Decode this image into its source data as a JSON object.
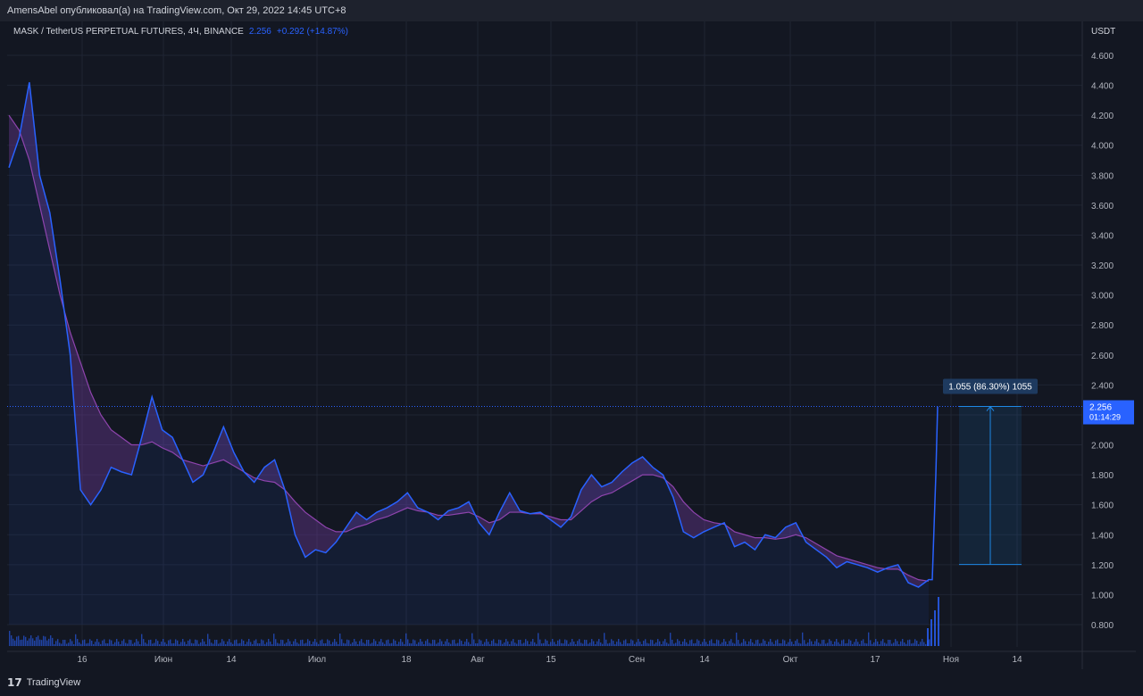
{
  "header": {
    "publisher_text": "AmensAbel опубликовал(а) на TradingView.com, Окт 29, 2022 14:45 UTC+8"
  },
  "symbol": {
    "name": "MASK / TetherUS PERPETUAL FUTURES, 4Ч, BINANCE",
    "price": "2.256",
    "change": "+0.292 (+14.87%)"
  },
  "price_axis": {
    "currency": "USDT",
    "ticks": [
      "4.600",
      "4.400",
      "4.200",
      "4.000",
      "3.800",
      "3.600",
      "3.400",
      "3.200",
      "3.000",
      "2.800",
      "2.600",
      "2.400",
      "2.200",
      "2.000",
      "1.800",
      "1.600",
      "1.400",
      "1.200",
      "1.000",
      "0.800"
    ]
  },
  "time_axis": {
    "ticks": [
      "16",
      "Июн",
      "14",
      "Июл",
      "18",
      "Авг",
      "15",
      "Сен",
      "14",
      "Окт",
      "17",
      "Ноя",
      "14"
    ]
  },
  "price_badge": {
    "price": "2.256",
    "countdown": "01:14:29"
  },
  "measure_label": "1.055 (86.30%) 1055",
  "footer": {
    "brand": "TradingView"
  },
  "colors": {
    "background": "#131722",
    "price_line": "#2962ff",
    "ribbon_purple": "#7b3fa8",
    "ribbon_green": "#26a69a",
    "measure": "#1e88e5"
  },
  "chart_data": {
    "type": "line",
    "ylabel": "USDT",
    "ylim": [
      0.7,
      4.75
    ],
    "x": [
      0,
      2,
      4,
      6,
      8,
      10,
      12,
      14,
      16,
      18,
      20,
      22,
      24,
      26,
      28,
      30,
      32,
      34,
      36,
      38,
      40,
      42,
      44,
      46,
      48,
      50,
      52,
      54,
      56,
      58,
      60,
      62,
      64,
      66,
      68,
      70,
      72,
      74,
      76,
      78,
      80,
      82,
      84,
      86,
      88,
      90,
      92,
      94,
      96,
      98,
      100,
      102,
      104,
      106,
      108,
      110,
      112,
      114,
      116,
      118,
      120,
      122,
      124,
      126,
      128,
      130,
      132,
      134,
      136,
      138,
      140,
      142,
      144,
      146,
      148,
      150,
      152,
      154,
      156,
      158,
      160,
      162,
      164,
      166,
      168,
      170,
      172,
      174,
      176,
      178,
      180
    ],
    "series": [
      {
        "values": [
          3.85,
          4.05,
          4.42,
          3.8,
          3.55,
          3.1,
          2.6,
          1.7,
          1.6,
          1.7,
          1.85,
          1.82,
          1.8,
          2.05,
          2.32,
          2.1,
          2.05,
          1.9,
          1.75,
          1.8,
          1.95,
          2.12,
          1.95,
          1.82,
          1.75,
          1.85,
          1.9,
          1.7,
          1.4,
          1.25,
          1.3,
          1.28,
          1.35,
          1.45,
          1.55,
          1.5,
          1.55,
          1.58,
          1.62,
          1.68,
          1.58,
          1.55,
          1.5,
          1.56,
          1.58,
          1.62,
          1.48,
          1.4,
          1.55,
          1.68,
          1.56,
          1.54,
          1.55,
          1.5,
          1.45,
          1.52,
          1.7,
          1.8,
          1.72,
          1.75,
          1.82,
          1.88,
          1.92,
          1.85,
          1.8,
          1.65,
          1.42,
          1.38,
          1.42,
          1.45,
          1.48,
          1.32,
          1.35,
          1.3,
          1.4,
          1.38,
          1.45,
          1.48,
          1.35,
          1.3,
          1.25,
          1.18,
          1.22,
          1.2,
          1.18,
          1.15,
          1.18,
          1.2,
          1.08,
          1.05,
          1.1
        ]
      },
      {
        "values": [
          4.2,
          4.1,
          3.9,
          3.6,
          3.3,
          3.0,
          2.75,
          2.55,
          2.35,
          2.2,
          2.1,
          2.05,
          2.0,
          2.0,
          2.02,
          1.98,
          1.95,
          1.9,
          1.88,
          1.86,
          1.88,
          1.9,
          1.86,
          1.82,
          1.78,
          1.76,
          1.75,
          1.7,
          1.62,
          1.55,
          1.5,
          1.45,
          1.42,
          1.42,
          1.45,
          1.47,
          1.5,
          1.52,
          1.55,
          1.58,
          1.56,
          1.55,
          1.53,
          1.53,
          1.54,
          1.55,
          1.52,
          1.48,
          1.5,
          1.55,
          1.55,
          1.54,
          1.54,
          1.52,
          1.5,
          1.5,
          1.56,
          1.62,
          1.66,
          1.68,
          1.72,
          1.76,
          1.8,
          1.8,
          1.78,
          1.72,
          1.62,
          1.55,
          1.5,
          1.48,
          1.47,
          1.42,
          1.4,
          1.38,
          1.38,
          1.37,
          1.38,
          1.4,
          1.38,
          1.34,
          1.3,
          1.26,
          1.24,
          1.22,
          1.2,
          1.18,
          1.17,
          1.17,
          1.13,
          1.1,
          1.09
        ]
      }
    ],
    "spike": {
      "from": 1.02,
      "to": 2.256
    },
    "measure": {
      "from": 1.201,
      "to": 2.256,
      "change": "1.055 (86.30%) 1055"
    },
    "last_price": 2.256
  }
}
